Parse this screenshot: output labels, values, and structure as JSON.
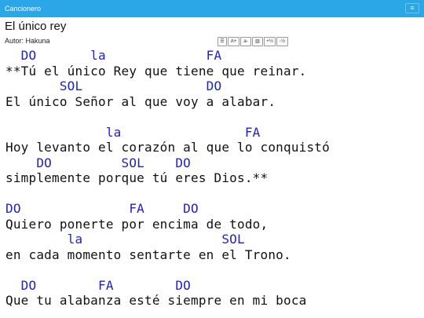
{
  "app": {
    "title": "Cancionero",
    "menu_icon": "≡"
  },
  "song": {
    "title": "El único rey",
    "author": "Autor: Hakuna"
  },
  "toolbar": {
    "buttons": [
      {
        "icon": "list-icon",
        "label": "☰"
      },
      {
        "icon": "font-increase-icon",
        "label": "A+"
      },
      {
        "icon": "font-decrease-icon",
        "label": "a-"
      },
      {
        "icon": "columns-icon",
        "label": "▥"
      },
      {
        "icon": "transpose-up-icon",
        "label": "+½"
      },
      {
        "icon": "transpose-down-icon",
        "label": "-½"
      }
    ]
  },
  "lines": [
    {
      "type": "chord",
      "text": "  DO       la             FA"
    },
    {
      "type": "lyric",
      "text": "**Tú el único Rey que tiene que reinar."
    },
    {
      "type": "chord",
      "text": "       SOL                DO"
    },
    {
      "type": "lyric",
      "text": "El único Señor al que voy a alabar."
    },
    {
      "type": "blank",
      "text": ""
    },
    {
      "type": "chord",
      "text": "             la                FA"
    },
    {
      "type": "lyric",
      "text": "Hoy levanto el corazón al que lo conquistó"
    },
    {
      "type": "chord",
      "text": "    DO         SOL    DO"
    },
    {
      "type": "lyric",
      "text": "simplemente porque tú eres Dios.**"
    },
    {
      "type": "blank",
      "text": ""
    },
    {
      "type": "chord",
      "text": "DO              FA     DO"
    },
    {
      "type": "lyric",
      "text": "Quiero ponerte por encima de todo,"
    },
    {
      "type": "chord",
      "text": "        la                  SOL"
    },
    {
      "type": "lyric",
      "text": "en cada momento sentarte en el Trono."
    },
    {
      "type": "blank",
      "text": ""
    },
    {
      "type": "chord",
      "text": "  DO        FA        DO"
    },
    {
      "type": "lyric",
      "text": "Que tu alabanza esté siempre en mi boca"
    }
  ]
}
